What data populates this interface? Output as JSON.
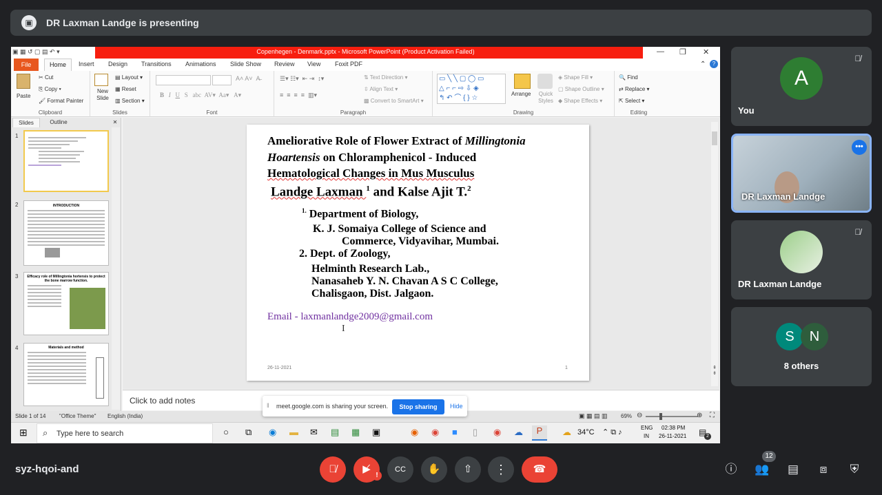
{
  "banner": {
    "text": "DR Laxman Landge is presenting"
  },
  "ppt": {
    "window_title": "Copenhegen - Denmark.pptx - Microsoft PowerPoint (Product Activation Failed)",
    "tabs": [
      "File",
      "Home",
      "Insert",
      "Design",
      "Transitions",
      "Animations",
      "Slide Show",
      "Review",
      "View",
      "Foxit PDF"
    ],
    "ribbon": {
      "clipboard": {
        "label": "Clipboard",
        "paste": "Paste",
        "cut": "Cut",
        "copy": "Copy",
        "format_painter": "Format Painter"
      },
      "slides": {
        "label": "Slides",
        "new_slide": "New Slide",
        "layout": "Layout",
        "reset": "Reset",
        "section": "Section"
      },
      "font": {
        "label": "Font"
      },
      "paragraph": {
        "label": "Paragraph",
        "text_direction": "Text Direction",
        "align_text": "Align Text",
        "convert": "Convert to SmartArt"
      },
      "drawing": {
        "label": "Drawing",
        "arrange": "Arrange",
        "quick_styles": "Quick Styles",
        "shape_fill": "Shape Fill",
        "shape_outline": "Shape Outline",
        "shape_effects": "Shape Effects"
      },
      "editing": {
        "label": "Editing",
        "find": "Find",
        "replace": "Replace",
        "select": "Select"
      }
    },
    "left_tabs": {
      "slides": "Slides",
      "outline": "Outline"
    },
    "thumbs": [
      {
        "num": "1"
      },
      {
        "num": "2",
        "title": "INTRODUCTION"
      },
      {
        "num": "3",
        "title": "Efficacy role of Millingtonia hortensis to protect the bone marrow function."
      },
      {
        "num": "4",
        "title": "Materials and method"
      }
    ],
    "slide": {
      "title_l1a": "Ameliorative  Role  of Flower Extract of ",
      "title_l1b": "Millingtonia",
      "title_l2a": "Hoartensis",
      "title_l2b": " on Chloramphenicol - Induced",
      "title_l3": "Hematological  Changes in Mus Musculus",
      "authors_a": "Landge Laxman ",
      "sup1": "1",
      "authors_b": " and Kalse Ajit T.",
      "sup2": "2",
      "aff1_num": "1.",
      "aff1_a": "Department of Biology,",
      "aff1_b": "K. J. Somaiya College of Science and",
      "aff1_c": "Commerce, Vidyavihar, Mumbai.",
      "aff2_a": "2. Dept. of Zoology,",
      "aff2_b": "Helminth Research Lab.,",
      "aff2_c": "Nanasaheb Y. N. Chavan A S C College,",
      "aff2_d": "Chalisgaon, Dist. Jalgaon.",
      "email": "Email - laxmanlandge2009@gmail.com",
      "footer_date": "26-11-2021",
      "footer_page": "1"
    },
    "notes_placeholder": "Click to add notes",
    "status": {
      "slide": "Slide 1 of 14",
      "theme": "\"Office Theme\"",
      "lang": "English (India)",
      "zoom": "69%"
    },
    "taskbar": {
      "search": "Type here to search",
      "temp": "34°C",
      "lang1": "ENG",
      "lang2": "IN",
      "time": "02:38 PM",
      "date": "26-11-2021",
      "notif": "2"
    },
    "share_popup": {
      "message": "meet.google.com is sharing your screen.",
      "stop": "Stop sharing",
      "hide": "Hide"
    }
  },
  "participants": [
    {
      "name": "You",
      "initial": "A"
    },
    {
      "name": "DR Laxman Landge"
    },
    {
      "name": "DR Laxman Landge"
    },
    {
      "name": "8 others",
      "initials": [
        "S",
        "N"
      ]
    }
  ],
  "meeting": {
    "code": "syz-hqoi-and",
    "participant_count": "12"
  },
  "colors": {
    "accent_blue": "#1a73e8",
    "end_call_red": "#ea4335",
    "ppt_orange": "#e8571e",
    "meet_bg": "#202124",
    "tile_bg": "#3c4043"
  }
}
